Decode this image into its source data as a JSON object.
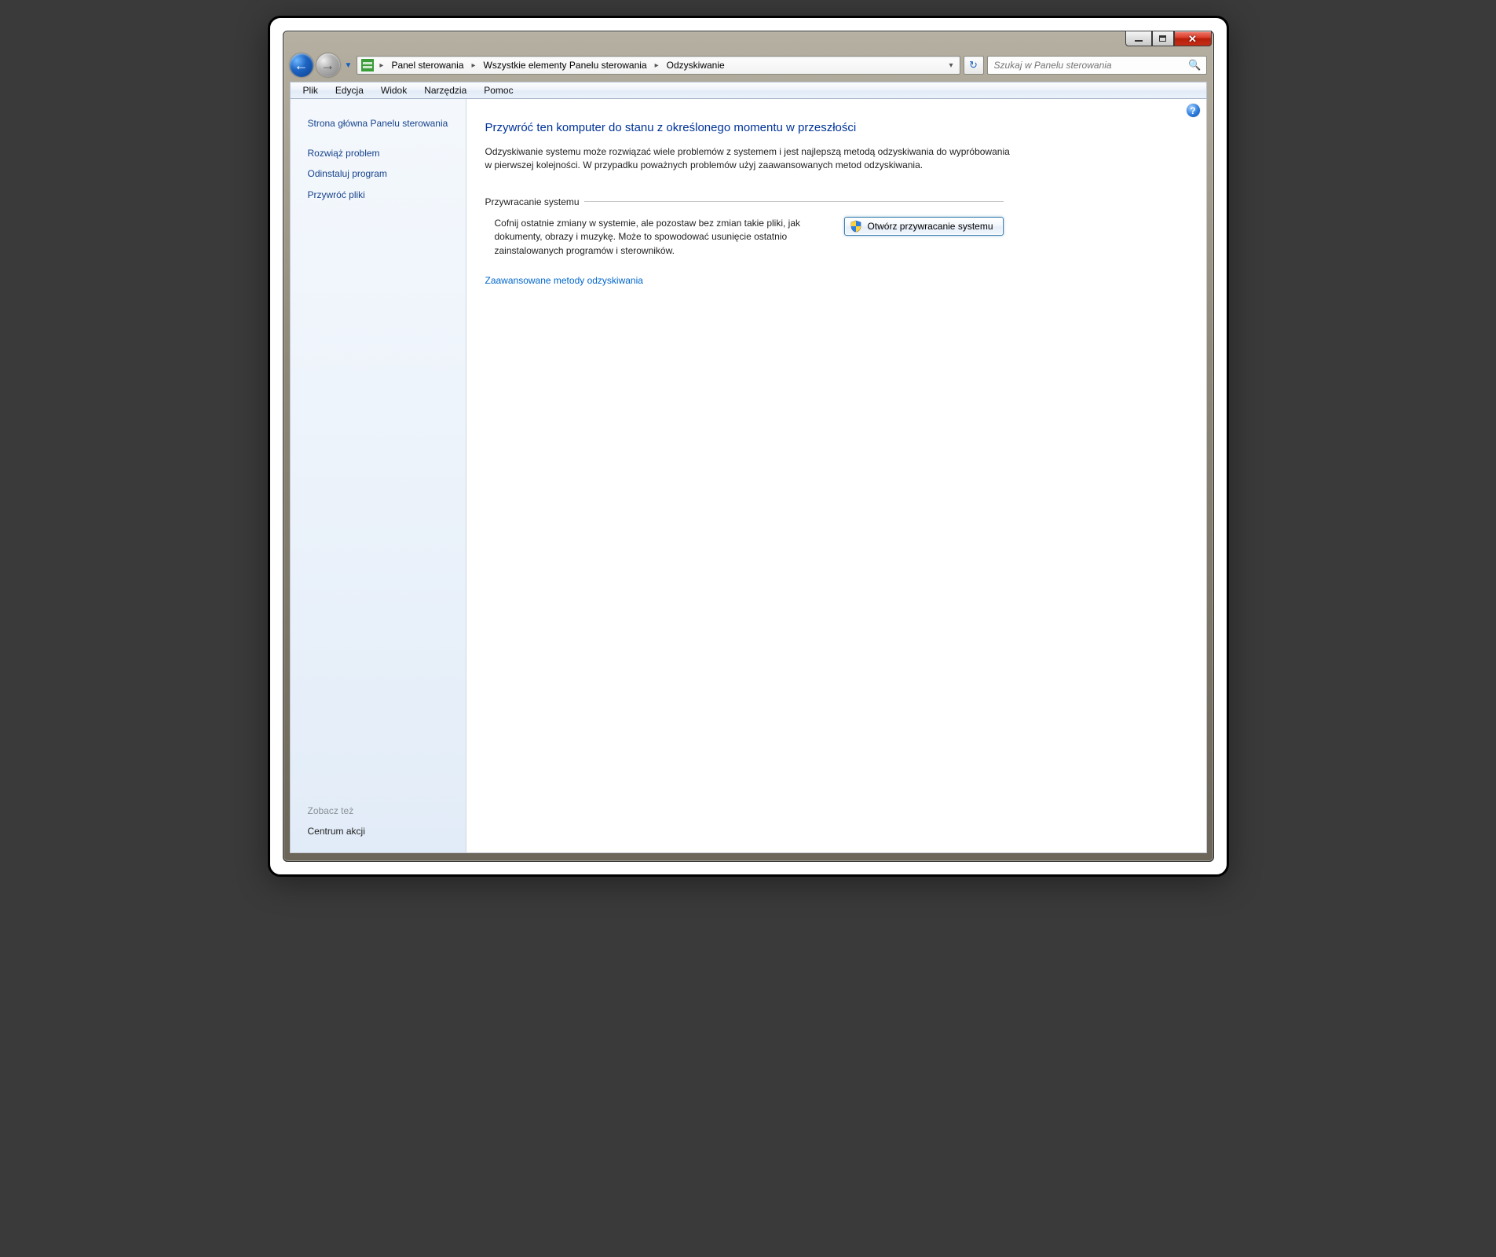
{
  "titlebar": {
    "minimize_label": "Minimize",
    "maximize_label": "Maximize",
    "close_label": "Close"
  },
  "nav": {
    "back_label": "Back",
    "forward_label": "Forward",
    "recent_label": "Recent pages",
    "refresh_label": "Refresh"
  },
  "breadcrumbs": {
    "item0": "Panel sterowania",
    "item1": "Wszystkie elementy Panelu sterowania",
    "item2": "Odzyskiwanie"
  },
  "search": {
    "placeholder": "Szukaj w Panelu sterowania"
  },
  "menu": {
    "item0": "Plik",
    "item1": "Edycja",
    "item2": "Widok",
    "item3": "Narzędzia",
    "item4": "Pomoc"
  },
  "sidebar": {
    "home": "Strona główna Panelu sterowania",
    "troubleshoot": "Rozwiąż problem",
    "uninstall": "Odinstaluj program",
    "restore_files": "Przywróć pliki",
    "see_also_label": "Zobacz też",
    "action_center": "Centrum akcji"
  },
  "content": {
    "heading": "Przywróć ten komputer do stanu z określonego momentu w przeszłości",
    "description": "Odzyskiwanie systemu może rozwiązać wiele problemów z systemem i jest najlepszą metodą odzyskiwania do wypróbowania w pierwszej kolejności. W przypadku poważnych problemów użyj zaawansowanych metod odzyskiwania.",
    "group_title": "Przywracanie systemu",
    "group_text": "Cofnij ostatnie zmiany w systemie, ale pozostaw bez zmian takie pliki, jak dokumenty, obrazy i muzykę. Może to spowodować usunięcie ostatnio zainstalowanych programów i sterowników.",
    "open_restore_button": "Otwórz przywracanie systemu",
    "advanced_link": "Zaawansowane metody odzyskiwania",
    "help_label": "?"
  }
}
